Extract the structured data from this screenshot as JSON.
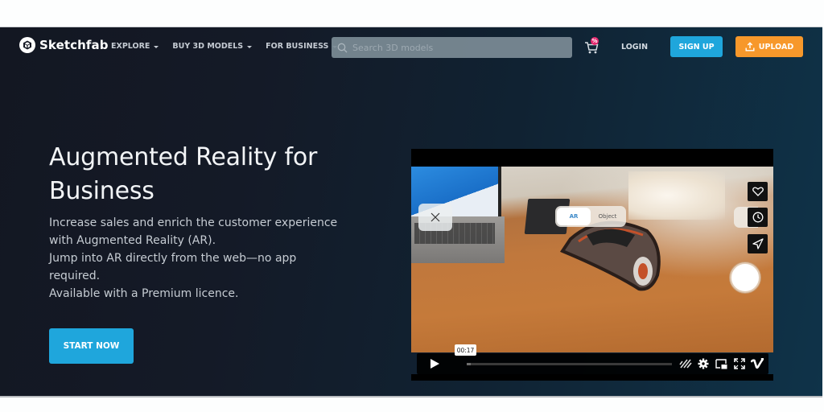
{
  "header": {
    "logo_text": "Sketchfab",
    "nav": [
      {
        "label": "EXPLORE",
        "icon": "chevron-down-icon"
      },
      {
        "label": "BUY 3D MODELS",
        "icon": "chevron-down-icon"
      },
      {
        "label": "FOR BUSINESS",
        "icon": "chevron-down-icon"
      }
    ],
    "search": {
      "placeholder": "Search 3D models",
      "value": "",
      "icon": "search-icon"
    },
    "cart": {
      "icon": "cart-icon",
      "badge": "%"
    },
    "login_label": "LOGIN",
    "signup_label": "SIGN UP",
    "upload_label": "UPLOAD"
  },
  "hero": {
    "title_line1": "Augmented Reality for",
    "title_line2": "Business",
    "description": [
      "Increase sales and enrich the customer experience with Augmented Reality (AR).",
      "Jump into AR directly from the web—no app required.",
      "Available with a Premium licence."
    ],
    "cta_label": "START NOW"
  },
  "video": {
    "mode_options": [
      "AR",
      "Object"
    ],
    "selected_mode": "AR",
    "side_icons": [
      "heart-icon",
      "clock-icon",
      "send-icon"
    ],
    "current_time": "00:17",
    "progress_fraction": 0.02,
    "control_icons": [
      "hd-off-icon",
      "settings-icon",
      "picture-in-picture-icon",
      "fullscreen-icon",
      "vimeo-icon"
    ]
  },
  "colors": {
    "primary": "#1fa6dc",
    "upload": "#f7982b",
    "badge": "#e5296f"
  }
}
